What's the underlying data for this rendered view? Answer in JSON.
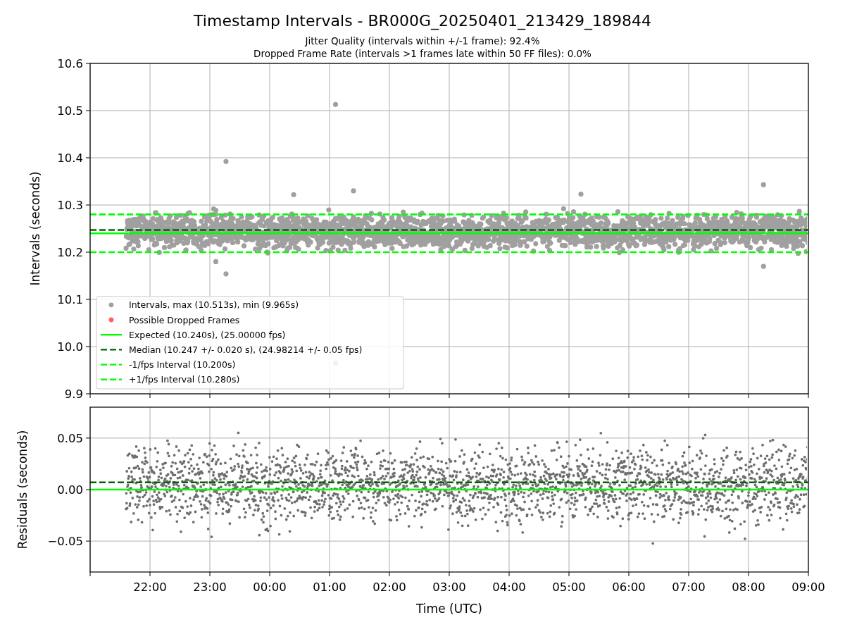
{
  "figure": {
    "title": "Timestamp Intervals - BR000G_20250401_213429_189844",
    "subtitles": [
      "Jitter Quality (intervals within +/-1 frame): 92.4%",
      "Dropped Frame Rate (intervals >1 frames late within 50 FF files): 0.0%"
    ]
  },
  "intervals_panel": {
    "legend_markers": [
      {
        "label": "Intervals, max (10.513s), min (9.965s)",
        "color": "#a0a0a0"
      },
      {
        "label": "Possible Dropped Frames",
        "color": "#ff6060"
      }
    ],
    "chart_data": {
      "type": "line",
      "grid": true,
      "legend": true,
      "ylabel": "Intervals (seconds)",
      "categories": [
        null,
        null,
        null,
        null,
        null,
        null,
        null,
        null,
        null,
        null,
        null,
        null,
        null
      ],
      "ylim": [
        9.9,
        10.6
      ],
      "yticks": [
        {
          "value": 9.9,
          "label": "9.9"
        },
        {
          "value": 10.0,
          "label": "10.0"
        },
        {
          "value": 10.1,
          "label": "10.1"
        },
        {
          "value": 10.2,
          "label": "10.2"
        },
        {
          "value": 10.3,
          "label": "10.3"
        },
        {
          "value": 10.4,
          "label": "10.4"
        },
        {
          "value": 10.5,
          "label": "10.5"
        },
        {
          "value": 10.6,
          "label": "10.6"
        }
      ],
      "series": [
        {
          "name": "Expected (10.240s), (25.00000 fps)",
          "color": "#00ff00",
          "line_style": "solid",
          "values": [
            10.24,
            10.24,
            10.24,
            10.24,
            10.24,
            10.24,
            10.24,
            10.24,
            10.24,
            10.24,
            10.24,
            10.24,
            10.24
          ]
        },
        {
          "name": "Median (10.247 +/- 0.020 s), (24.98214 +/- 0.05 fps)",
          "color": "#006400",
          "line_style": "dashed",
          "values": [
            10.247,
            10.247,
            10.247,
            10.247,
            10.247,
            10.247,
            10.247,
            10.247,
            10.247,
            10.247,
            10.247,
            10.247,
            10.247
          ]
        },
        {
          "name": "-1/fps Interval (10.200s)",
          "color": "#00ff00",
          "line_style": "dashed",
          "values": [
            10.2,
            10.2,
            10.2,
            10.2,
            10.2,
            10.2,
            10.2,
            10.2,
            10.2,
            10.2,
            10.2,
            10.2,
            10.2
          ]
        },
        {
          "name": "+1/fps Interval (10.280s)",
          "color": "#00ff00",
          "line_style": "dashed",
          "values": [
            10.28,
            10.28,
            10.28,
            10.28,
            10.28,
            10.28,
            10.28,
            10.28,
            10.28,
            10.28,
            10.28,
            10.28,
            10.28
          ]
        }
      ]
    }
  },
  "residuals_panel": {
    "chart_data": {
      "type": "line",
      "grid": true,
      "xlabel": "Time (UTC)",
      "ylabel": "Residuals (seconds)",
      "categories": [
        null,
        "22:00",
        "23:00",
        "00:00",
        "01:00",
        "02:00",
        "03:00",
        "04:00",
        "05:00",
        "06:00",
        "07:00",
        "08:00",
        "09:00"
      ],
      "ylim": [
        -0.08,
        0.08
      ],
      "yticks": [
        {
          "value": -0.05,
          "label": "−0.05"
        },
        {
          "value": 0,
          "label": "0.00"
        },
        {
          "value": 0.05,
          "label": "0.05"
        }
      ],
      "series": [
        {
          "color": "#00ff00",
          "line_style": "solid",
          "values": [
            0,
            0,
            0,
            0,
            0,
            0,
            0,
            0,
            0,
            0,
            0,
            0,
            0
          ]
        },
        {
          "color": "#006400",
          "line_style": "dashed",
          "values": [
            0.007,
            0.007,
            0.007,
            0.007,
            0.007,
            0.007,
            0.007,
            0.007,
            0.007,
            0.007,
            0.007,
            0.007,
            0.007
          ]
        }
      ]
    }
  }
}
